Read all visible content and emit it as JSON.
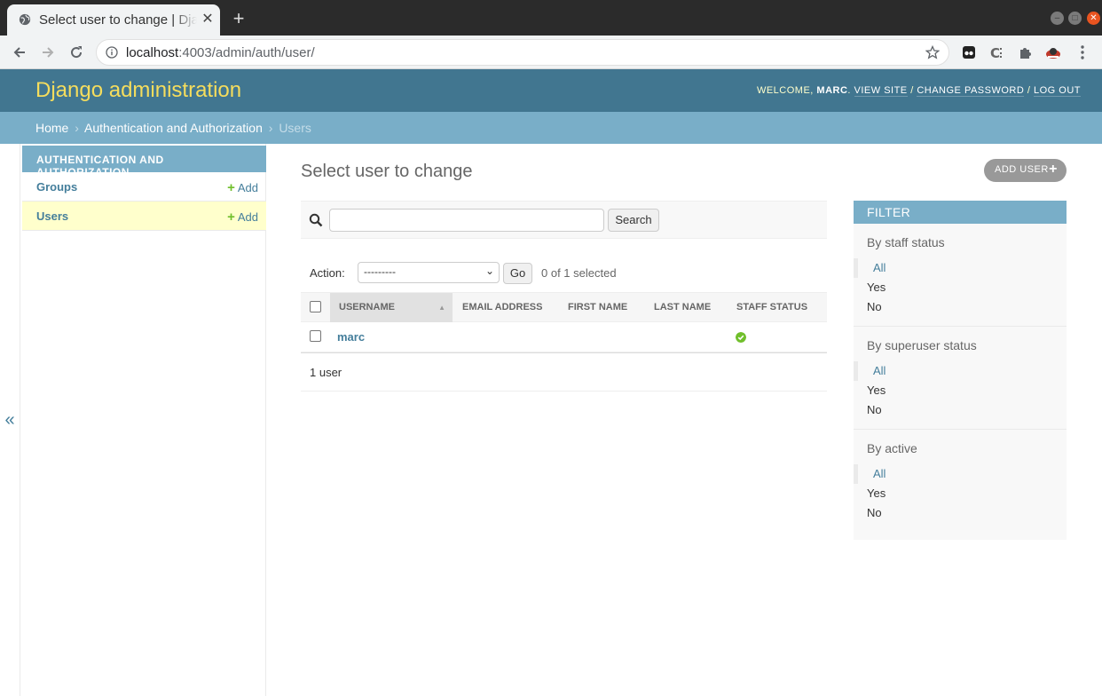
{
  "browser": {
    "tab_title": "Select user to change | Django site admin",
    "close_glyph": "✕",
    "new_tab_glyph": "+",
    "url_host": "localhost",
    "url_rest": ":4003/admin/auth/user/"
  },
  "header": {
    "branding": "Django administration",
    "welcome": "Welcome,",
    "username": "marc",
    "view_site": "View site",
    "change_password": "Change password",
    "log_out": "Log out",
    "sep": " / "
  },
  "breadcrumbs": {
    "home": "Home",
    "app": "Authentication and Authorization",
    "current": "Users",
    "sep": "›"
  },
  "nav": {
    "caption": "Authentication and Authorization",
    "items": [
      {
        "label": "Groups",
        "add": "Add"
      },
      {
        "label": "Users",
        "add": "Add"
      }
    ],
    "collapse": "«"
  },
  "main": {
    "title": "Select user to change",
    "add_user": "Add user",
    "search_button": "Search",
    "search_value": "",
    "action_label": "Action:",
    "action_selected": "---------",
    "go": "Go",
    "counter": "0 of 1 selected",
    "columns": [
      "Username",
      "Email address",
      "First name",
      "Last name",
      "Staff status"
    ],
    "rows": [
      {
        "username": "marc",
        "email": "",
        "first_name": "",
        "last_name": "",
        "staff_status": true
      }
    ],
    "paginator": "1 user"
  },
  "filter": {
    "title": "Filter",
    "groups": [
      {
        "heading": "By staff status",
        "choices": [
          "All",
          "Yes",
          "No"
        ],
        "selected": "All"
      },
      {
        "heading": "By superuser status",
        "choices": [
          "All",
          "Yes",
          "No"
        ],
        "selected": "All"
      },
      {
        "heading": "By active",
        "choices": [
          "All",
          "Yes",
          "No"
        ],
        "selected": "All"
      }
    ]
  },
  "colors": {
    "header_bg": "#417690",
    "branding": "#f5dd5d",
    "breadcrumb_bg": "#79aec8",
    "link": "#447e9b",
    "add_green": "#70bf2b",
    "current_row": "#ffffcc"
  }
}
